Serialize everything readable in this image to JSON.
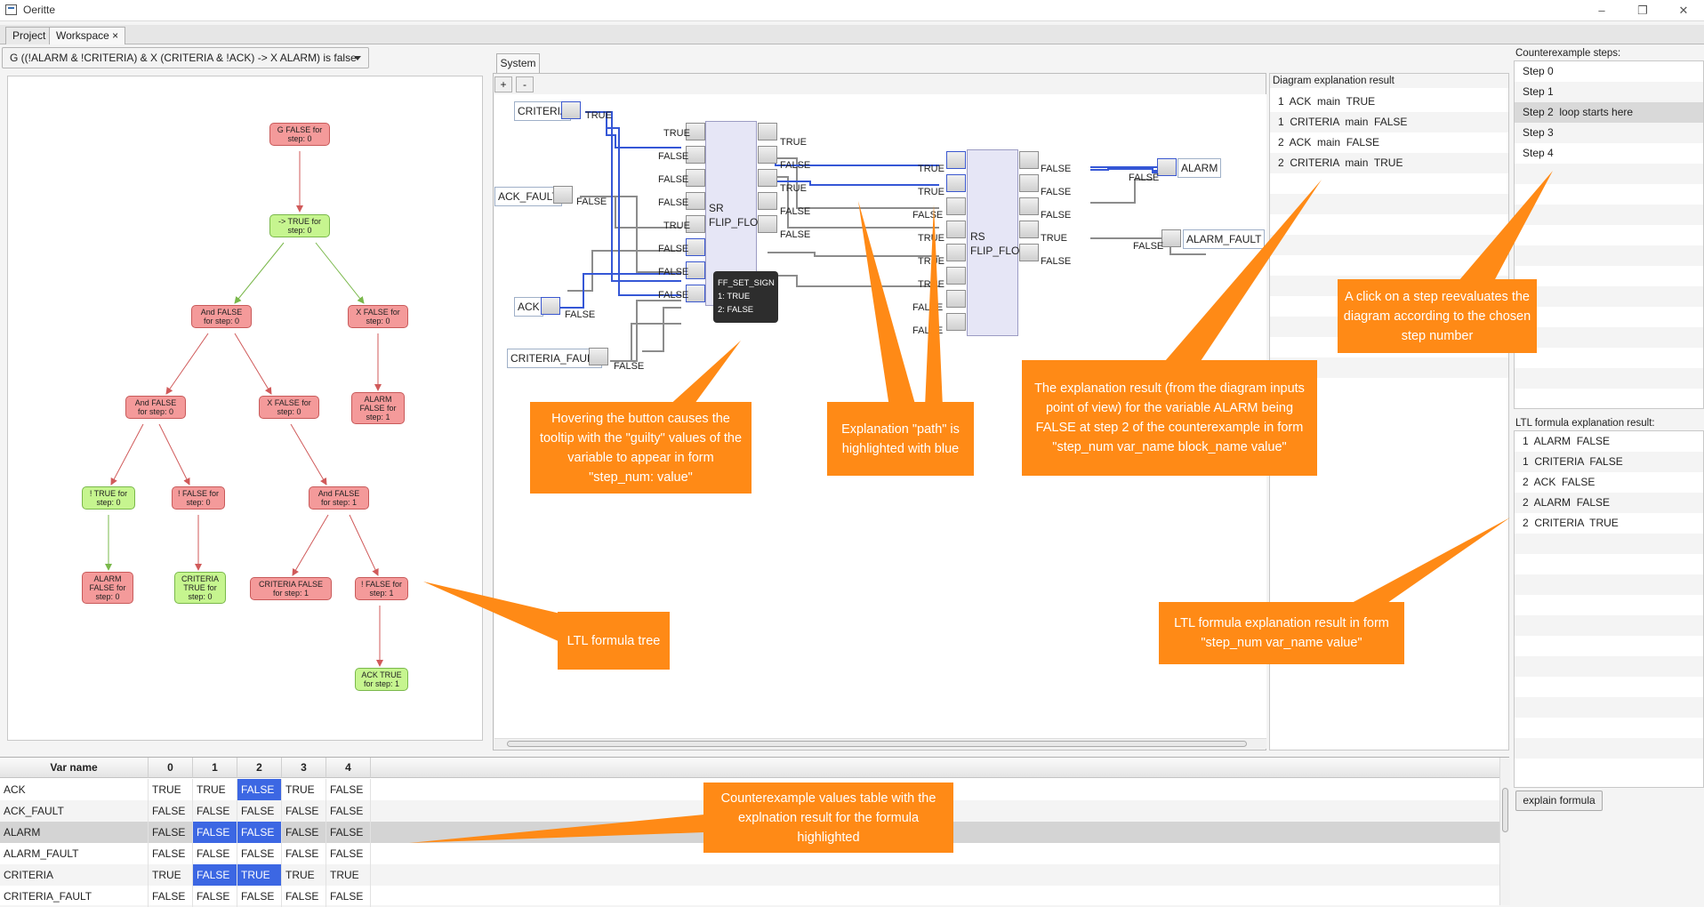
{
  "window": {
    "title": "Oeritte"
  },
  "tabs": [
    {
      "label": "Project"
    },
    {
      "label": "Workspace",
      "close": "×"
    }
  ],
  "formula_selector": "G ((!ALARM & !CRITERIA) & X (CRITERIA & !ACK) -> X ALARM) is false",
  "tree_nodes": [
    {
      "id": "g",
      "line1": "G FALSE for",
      "line2": "step: 0",
      "value": false
    },
    {
      "id": "impl",
      "line1": "-> TRUE for",
      "line2": "step: 0",
      "value": true
    },
    {
      "id": "and1",
      "line1": "And FALSE",
      "line2": "for step: 0",
      "value": false
    },
    {
      "id": "x1",
      "line1": "X FALSE for",
      "line2": "step: 0",
      "value": false
    },
    {
      "id": "and2",
      "line1": "And FALSE",
      "line2": "for step: 0",
      "value": false
    },
    {
      "id": "x2",
      "line1": "X FALSE for",
      "line2": "step: 0",
      "value": false
    },
    {
      "id": "alarm1",
      "line1": "ALARM",
      "line2": "FALSE for",
      "line3": "step: 1",
      "value": false
    },
    {
      "id": "not1",
      "line1": "! TRUE for",
      "line2": "step: 0",
      "value": true
    },
    {
      "id": "not2",
      "line1": "! FALSE for",
      "line2": "step: 0",
      "value": false
    },
    {
      "id": "and3",
      "line1": "And FALSE",
      "line2": "for step: 1",
      "value": false
    },
    {
      "id": "alarm0",
      "line1": "ALARM",
      "line2": "FALSE for",
      "line3": "step: 0",
      "value": false
    },
    {
      "id": "crit0",
      "line1": "CRITERIA",
      "line2": "TRUE for",
      "line3": "step: 0",
      "value": true
    },
    {
      "id": "crit1",
      "line1": "CRITERIA FALSE",
      "line2": "for step: 1",
      "value": false
    },
    {
      "id": "not3",
      "line1": "! FALSE for",
      "line2": "step: 1",
      "value": false
    },
    {
      "id": "ack1",
      "line1": "ACK TRUE",
      "line2": "for step: 1",
      "value": true
    }
  ],
  "system": {
    "tab": "System",
    "zoom_in": "+",
    "zoom_out": "-",
    "inputs": {
      "criteria": "CRITERIA",
      "ack_fault": "ACK_FAULT",
      "ack": "ACK",
      "criteria_fault": "CRITERIA_FAULT"
    },
    "outputs": {
      "alarm": "ALARM",
      "alarm_fault": "ALARM_FAULT"
    },
    "input_values": {
      "criteria": "TRUE",
      "ack_fault": "FALSE",
      "ack": "FALSE",
      "criteria_fault": "FALSE"
    },
    "sr_block": {
      "name_line1": "SR",
      "name_line2": "FLIP_FLOP",
      "in_labels": [
        "TRUE",
        "FALSE",
        "FALSE",
        "FALSE",
        "TRUE",
        "FALSE",
        "FALSE",
        "FALSE"
      ],
      "out_labels": [
        "TRUE",
        "FALSE",
        "TRUE",
        "FALSE",
        "FALSE"
      ]
    },
    "rs_block": {
      "name_line1": "RS",
      "name_line2": "FLIP_FLOP",
      "in_labels": [
        "TRUE",
        "TRUE",
        "FALSE",
        "TRUE",
        "TRUE",
        "TRUE",
        "FALSE",
        "FALSE"
      ],
      "out_labels": [
        "FALSE",
        "FALSE",
        "FALSE",
        "TRUE",
        "FALSE"
      ]
    },
    "alarm_value": "FALSE",
    "alarm_fault_value": "FALSE",
    "tooltip": {
      "title": "FF_SET_SIGN",
      "line1": "1: TRUE",
      "line2": "2: FALSE"
    }
  },
  "diagram_explanation": {
    "header": "Diagram explanation result",
    "rows": [
      "1  ACK  main  TRUE",
      "1  CRITERIA  main  FALSE",
      "2  ACK  main  FALSE",
      "2  CRITERIA  main  TRUE"
    ]
  },
  "counterexample_steps": {
    "header": "Counterexample steps:",
    "steps": [
      "Step 0",
      "Step 1",
      "Step 2  loop starts here",
      "Step 3",
      "Step 4"
    ],
    "selected_index": 2
  },
  "ltl_explanation": {
    "header": "LTL formula explanation result:",
    "rows": [
      "1  ALARM  FALSE",
      "1  CRITERIA  FALSE",
      "2  ACK  FALSE",
      "2  ALARM  FALSE",
      "2  CRITERIA  TRUE"
    ]
  },
  "explain_button": "explain formula",
  "values_table": {
    "headers": [
      "Var name",
      "0",
      "1",
      "2",
      "3",
      "4"
    ],
    "rows": [
      {
        "name": "ACK",
        "values": [
          "TRUE",
          "TRUE",
          "FALSE",
          "TRUE",
          "FALSE"
        ],
        "highlight": [
          2
        ]
      },
      {
        "name": "ACK_FAULT",
        "values": [
          "FALSE",
          "FALSE",
          "FALSE",
          "FALSE",
          "FALSE"
        ],
        "highlight": []
      },
      {
        "name": "ALARM",
        "values": [
          "FALSE",
          "FALSE",
          "FALSE",
          "FALSE",
          "FALSE"
        ],
        "highlight": [
          1,
          2
        ]
      },
      {
        "name": "ALARM_FAULT",
        "values": [
          "FALSE",
          "FALSE",
          "FALSE",
          "FALSE",
          "FALSE"
        ],
        "highlight": []
      },
      {
        "name": "CRITERIA",
        "values": [
          "TRUE",
          "FALSE",
          "TRUE",
          "TRUE",
          "TRUE"
        ],
        "highlight": [
          1,
          2
        ]
      },
      {
        "name": "CRITERIA_FAULT",
        "values": [
          "FALSE",
          "FALSE",
          "FALSE",
          "FALSE",
          "FALSE"
        ],
        "highlight": []
      }
    ],
    "selected_row": 2
  },
  "annotations": {
    "hover": "Hovering the button causes the tooltip with the \"guilty\" values of the variable to appear in form \"step_num: value\"",
    "path": "Explanation \"path\" is highlighted with blue",
    "diagram": "The explanation result (from the diagram inputs point of view) for the variable ALARM being FALSE at step 2 of the counterexample in form \"step_num var_name block_name value\"",
    "step": "A click on a step reevaluates the diagram according to the chosen step number",
    "tree": "LTL formula tree",
    "ltl": "LTL formula explanation result in form \"step_num var_name value\"",
    "table": "Counterexample values table with the explnation result for the formula highlighted"
  },
  "colors": {
    "node_false": "#f49a9a",
    "node_true": "#c6f58f",
    "highlight_blue": "#3c67e3",
    "annotation": "#ff8a16",
    "path_blue": "#3557d6"
  }
}
